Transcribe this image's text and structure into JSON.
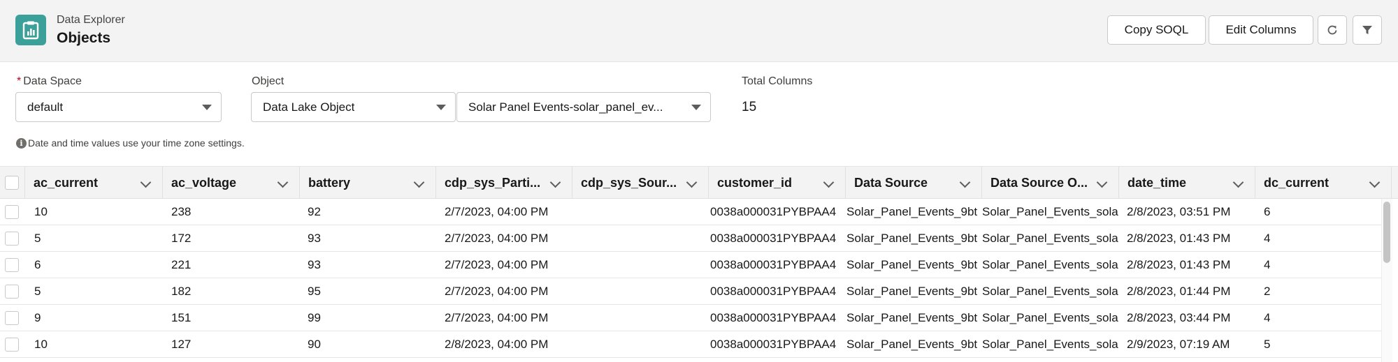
{
  "header": {
    "eyebrow": "Data Explorer",
    "title": "Objects",
    "app_icon": "clipboard-chart-icon",
    "accent_color": "#3ba09a",
    "buttons": {
      "copy_soql": "Copy SOQL",
      "edit_columns": "Edit Columns",
      "refresh_icon": "refresh-icon",
      "filter_icon": "filter-icon"
    }
  },
  "filters": {
    "data_space": {
      "required_mark": "*",
      "label": "Data Space",
      "value": "default"
    },
    "object": {
      "label": "Object",
      "type_value": "Data Lake Object",
      "object_value": "Solar Panel Events-solar_panel_ev..."
    },
    "total_columns": {
      "label": "Total Columns",
      "value": "15"
    },
    "info_text": "Date and time values use your time zone settings."
  },
  "table": {
    "columns": [
      "ac_current",
      "ac_voltage",
      "battery",
      "cdp_sys_Parti...",
      "cdp_sys_Sour...",
      "customer_id",
      "Data Source",
      "Data Source O...",
      "date_time",
      "dc_current"
    ],
    "rows": [
      [
        "10",
        "238",
        "92",
        "2/7/2023, 04:00 PM",
        "",
        "0038a000031PYBPAA4",
        "Solar_Panel_Events_9bt",
        "Solar_Panel_Events_sola",
        "2/8/2023, 03:51 PM",
        "6"
      ],
      [
        "5",
        "172",
        "93",
        "2/7/2023, 04:00 PM",
        "",
        "0038a000031PYBPAA4",
        "Solar_Panel_Events_9bt",
        "Solar_Panel_Events_sola",
        "2/8/2023, 01:43 PM",
        "4"
      ],
      [
        "6",
        "221",
        "93",
        "2/7/2023, 04:00 PM",
        "",
        "0038a000031PYBPAA4",
        "Solar_Panel_Events_9bt",
        "Solar_Panel_Events_sola",
        "2/8/2023, 01:43 PM",
        "4"
      ],
      [
        "5",
        "182",
        "95",
        "2/7/2023, 04:00 PM",
        "",
        "0038a000031PYBPAA4",
        "Solar_Panel_Events_9bt",
        "Solar_Panel_Events_sola",
        "2/8/2023, 01:44 PM",
        "2"
      ],
      [
        "9",
        "151",
        "99",
        "2/7/2023, 04:00 PM",
        "",
        "0038a000031PYBPAA4",
        "Solar_Panel_Events_9bt",
        "Solar_Panel_Events_sola",
        "2/8/2023, 03:44 PM",
        "4"
      ],
      [
        "10",
        "127",
        "90",
        "2/8/2023, 04:00 PM",
        "",
        "0038a000031PYBPAA4",
        "Solar_Panel_Events_9bt",
        "Solar_Panel_Events_sola",
        "2/9/2023, 07:19 AM",
        "5"
      ]
    ]
  }
}
